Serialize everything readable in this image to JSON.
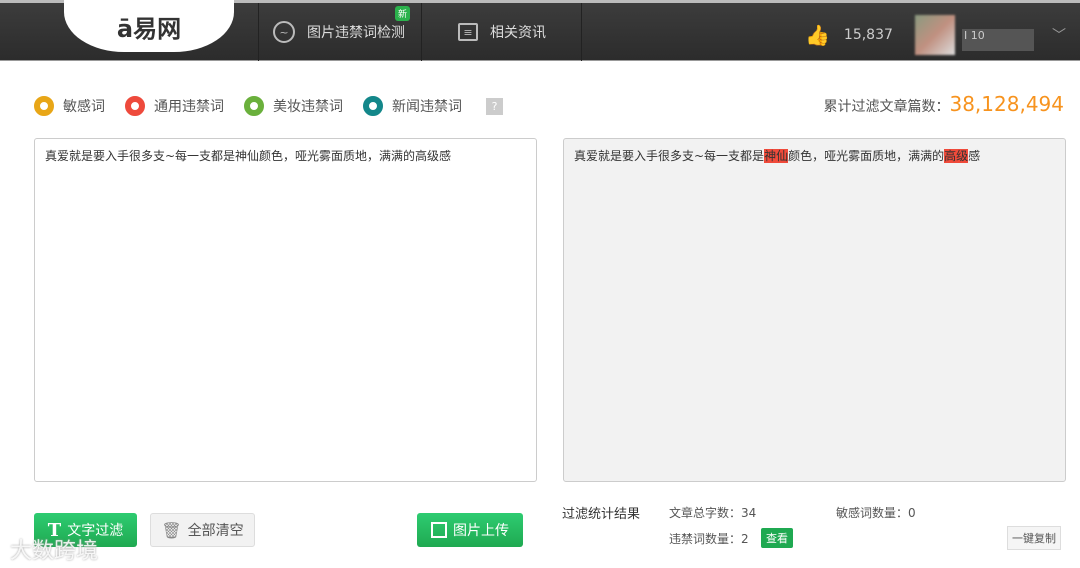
{
  "header": {
    "logo": "ā易网",
    "nav": [
      {
        "label": "图片违禁词检测",
        "badge": "新"
      },
      {
        "label": "相关资讯"
      }
    ],
    "likes": "15,837",
    "user": "I          10"
  },
  "legend": [
    {
      "label": "敏感词",
      "color": "#e8a617"
    },
    {
      "label": "通用违禁词",
      "color": "#ee4a3c"
    },
    {
      "label": "美妆违禁词",
      "color": "#6ab03c"
    },
    {
      "label": "新闻违禁词",
      "color": "#13878a"
    }
  ],
  "help": "?",
  "total": {
    "label": "累计过滤文章篇数：",
    "value": "38,128,494"
  },
  "input_text": "真爱就是要入手很多支~每一支都是神仙颜色，哑光雾面质地，满满的高级感",
  "output": {
    "p1": "真爱就是要入手很多支~每一支都是",
    "h1": "神仙",
    "p2": "颜色，哑光雾面质地，满满的",
    "h2": "高级",
    "p3": "感",
    "highlight_color": "#f04a3a"
  },
  "buttons": {
    "filter": "文字过滤",
    "clear": "全部清空",
    "upload": "图片上传",
    "view": "查看",
    "copy": "一键复制"
  },
  "stats": {
    "title": "过滤统计结果",
    "total_chars": "文章总字数：34",
    "sensitive": "敏感词数量：0",
    "banned": "违禁词数量：2"
  },
  "watermark": "大数跨境"
}
